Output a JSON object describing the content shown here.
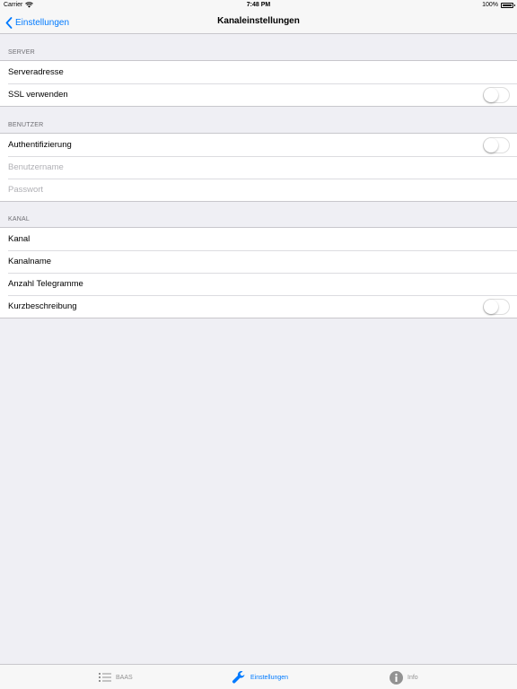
{
  "status_bar": {
    "carrier": "Carrier",
    "time": "7:48 PM",
    "battery": "100%",
    "battery_level": 1.0
  },
  "nav": {
    "back_label": "Einstellungen",
    "title": "Kanaleinstellungen"
  },
  "sections": {
    "server": {
      "header": "SERVER",
      "rows": {
        "server_address": "Serveradresse",
        "use_ssl": "SSL verwenden"
      }
    },
    "user": {
      "header": "BENUTZER",
      "rows": {
        "authentication": "Authentifizierung",
        "username_placeholder": "Benutzername",
        "password_placeholder": "Passwort"
      }
    },
    "channel": {
      "header": "KANAL",
      "rows": {
        "channel": "Kanal",
        "channel_name": "Kanalname",
        "telegram_count": "Anzahl Telegramme",
        "short_description": "Kurzbeschreibung"
      }
    }
  },
  "toggles": {
    "use_ssl": false,
    "authentication": false,
    "short_description": false
  },
  "tab_bar": {
    "tabs": [
      {
        "label": "BAAS",
        "icon": "list-icon",
        "active": false
      },
      {
        "label": "Einstellungen",
        "icon": "wrench-icon",
        "active": true
      },
      {
        "label": "Info",
        "icon": "info-icon",
        "active": false
      }
    ]
  },
  "colors": {
    "accent": "#007aff",
    "background": "#efeff4",
    "inactive_tab": "#929292"
  }
}
